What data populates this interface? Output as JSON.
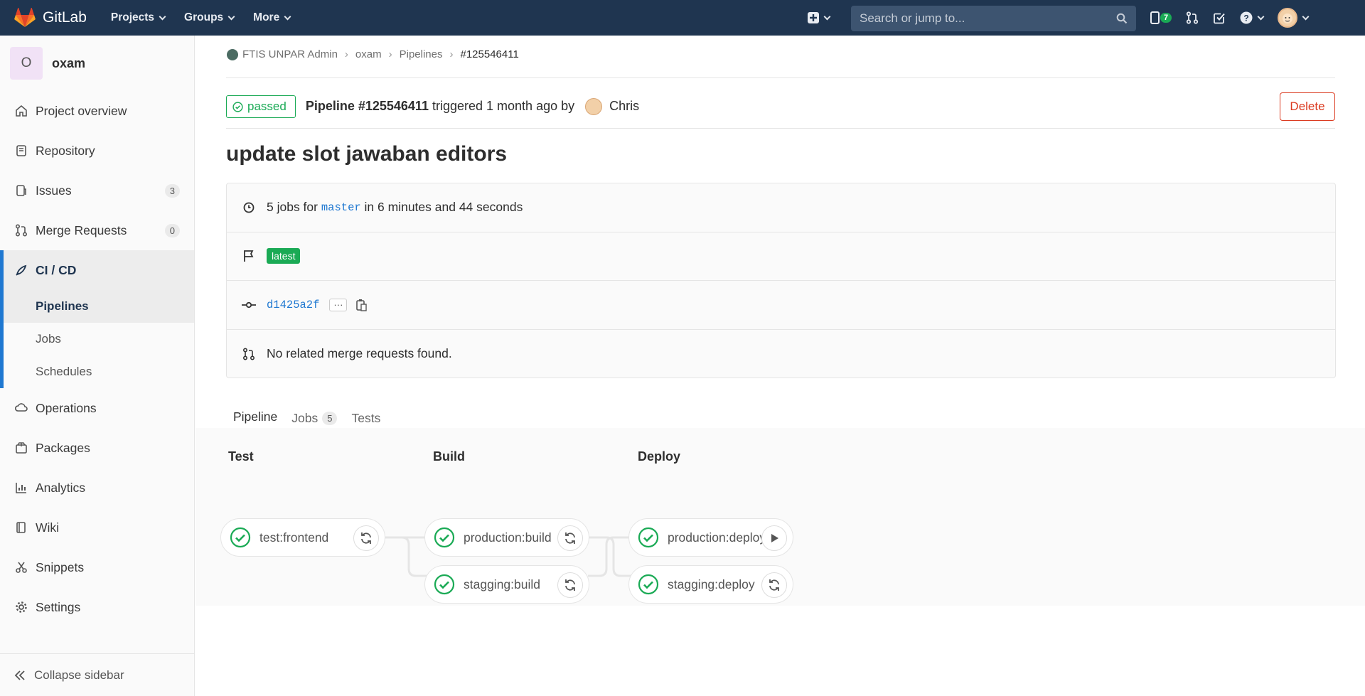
{
  "topbar": {
    "brand": "GitLab",
    "menu": [
      "Projects",
      "Groups",
      "More"
    ],
    "search_placeholder": "Search or jump to...",
    "todo_count": "7"
  },
  "sidebar": {
    "project_initial": "O",
    "project_name": "oxam",
    "items": [
      {
        "label": "Project overview"
      },
      {
        "label": "Repository"
      },
      {
        "label": "Issues",
        "badge": "3"
      },
      {
        "label": "Merge Requests",
        "badge": "0"
      },
      {
        "label": "CI / CD"
      },
      {
        "label": "Operations"
      },
      {
        "label": "Packages"
      },
      {
        "label": "Analytics"
      },
      {
        "label": "Wiki"
      },
      {
        "label": "Snippets"
      },
      {
        "label": "Settings"
      }
    ],
    "cicd_sub": [
      "Pipelines",
      "Jobs",
      "Schedules"
    ],
    "collapse_label": "Collapse sidebar"
  },
  "breadcrumb": [
    "FTIS UNPAR Admin",
    "oxam",
    "Pipelines",
    "#125546411"
  ],
  "pipeline": {
    "status": "passed",
    "title": "Pipeline #125546411",
    "triggered_text": "triggered 1 month ago by",
    "user": "Chris",
    "delete_label": "Delete",
    "commit_title": "update slot jawaban editors",
    "jobs_prefix": "5 jobs for",
    "branch": "master",
    "duration_text": "in 6 minutes and 44 seconds",
    "latest_label": "latest",
    "commit_sha": "d1425a2f",
    "more_label": "···",
    "mr_text": "No related merge requests found."
  },
  "tabs": [
    {
      "label": "Pipeline"
    },
    {
      "label": "Jobs",
      "count": "5"
    },
    {
      "label": "Tests"
    }
  ],
  "stages": [
    {
      "name": "Test",
      "jobs": [
        {
          "name": "test:frontend",
          "action": "retry"
        }
      ]
    },
    {
      "name": "Build",
      "jobs": [
        {
          "name": "production:build",
          "action": "retry"
        },
        {
          "name": "stagging:build",
          "action": "retry"
        }
      ]
    },
    {
      "name": "Deploy",
      "jobs": [
        {
          "name": "production:deploy",
          "action": "play"
        },
        {
          "name": "stagging:deploy",
          "action": "retry"
        }
      ]
    }
  ],
  "colors": {
    "topbar": "#1f3550",
    "success": "#1aaa55",
    "danger": "#db3b21",
    "link": "#1f78d1"
  }
}
